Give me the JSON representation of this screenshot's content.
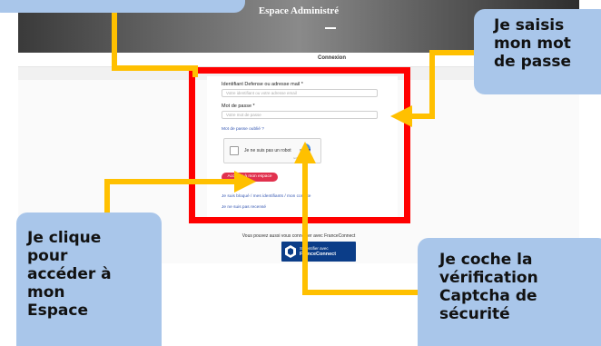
{
  "site": {
    "title": "Espace Administré",
    "tab_label": "Connexion",
    "form": {
      "identifier_label": "Identifiant Defense ou adresse mail *",
      "identifier_placeholder": "Votre identifiant ou votre adresse email",
      "password_label": "Mot de passe *",
      "password_placeholder": "Votre mot de passe",
      "forgot_password_link": "Mot de passe oublié ?",
      "captcha_label": "Je ne suis pas un robot",
      "captcha_brand": "reCAPTCHA",
      "submit_label": "Accéder à mon espace",
      "lost_identifiers_link": "Je suis bloqué / mes identifiants / mon compte",
      "blocked_link": "Je ne suis pas recensé"
    },
    "franceconnect": {
      "note": "Vous pouvez aussi vous connecter avec FranceConnect",
      "line1": "S'identifier avec",
      "line2": "FranceConnect"
    }
  },
  "callouts": {
    "password": [
      "Je saisis",
      "mon mot",
      "de passe"
    ],
    "click": [
      "Je clique",
      "pour",
      "accéder à",
      "mon",
      "Espace"
    ],
    "captcha": [
      "Je coche la",
      "vérification",
      "Captcha de",
      "sécurité"
    ]
  },
  "colors": {
    "highlight": "#ff0000",
    "arrow": "#ffc000",
    "callout": "#a9c6ea",
    "submit": "#e1314e",
    "franceconnect": "#0b3d88"
  }
}
